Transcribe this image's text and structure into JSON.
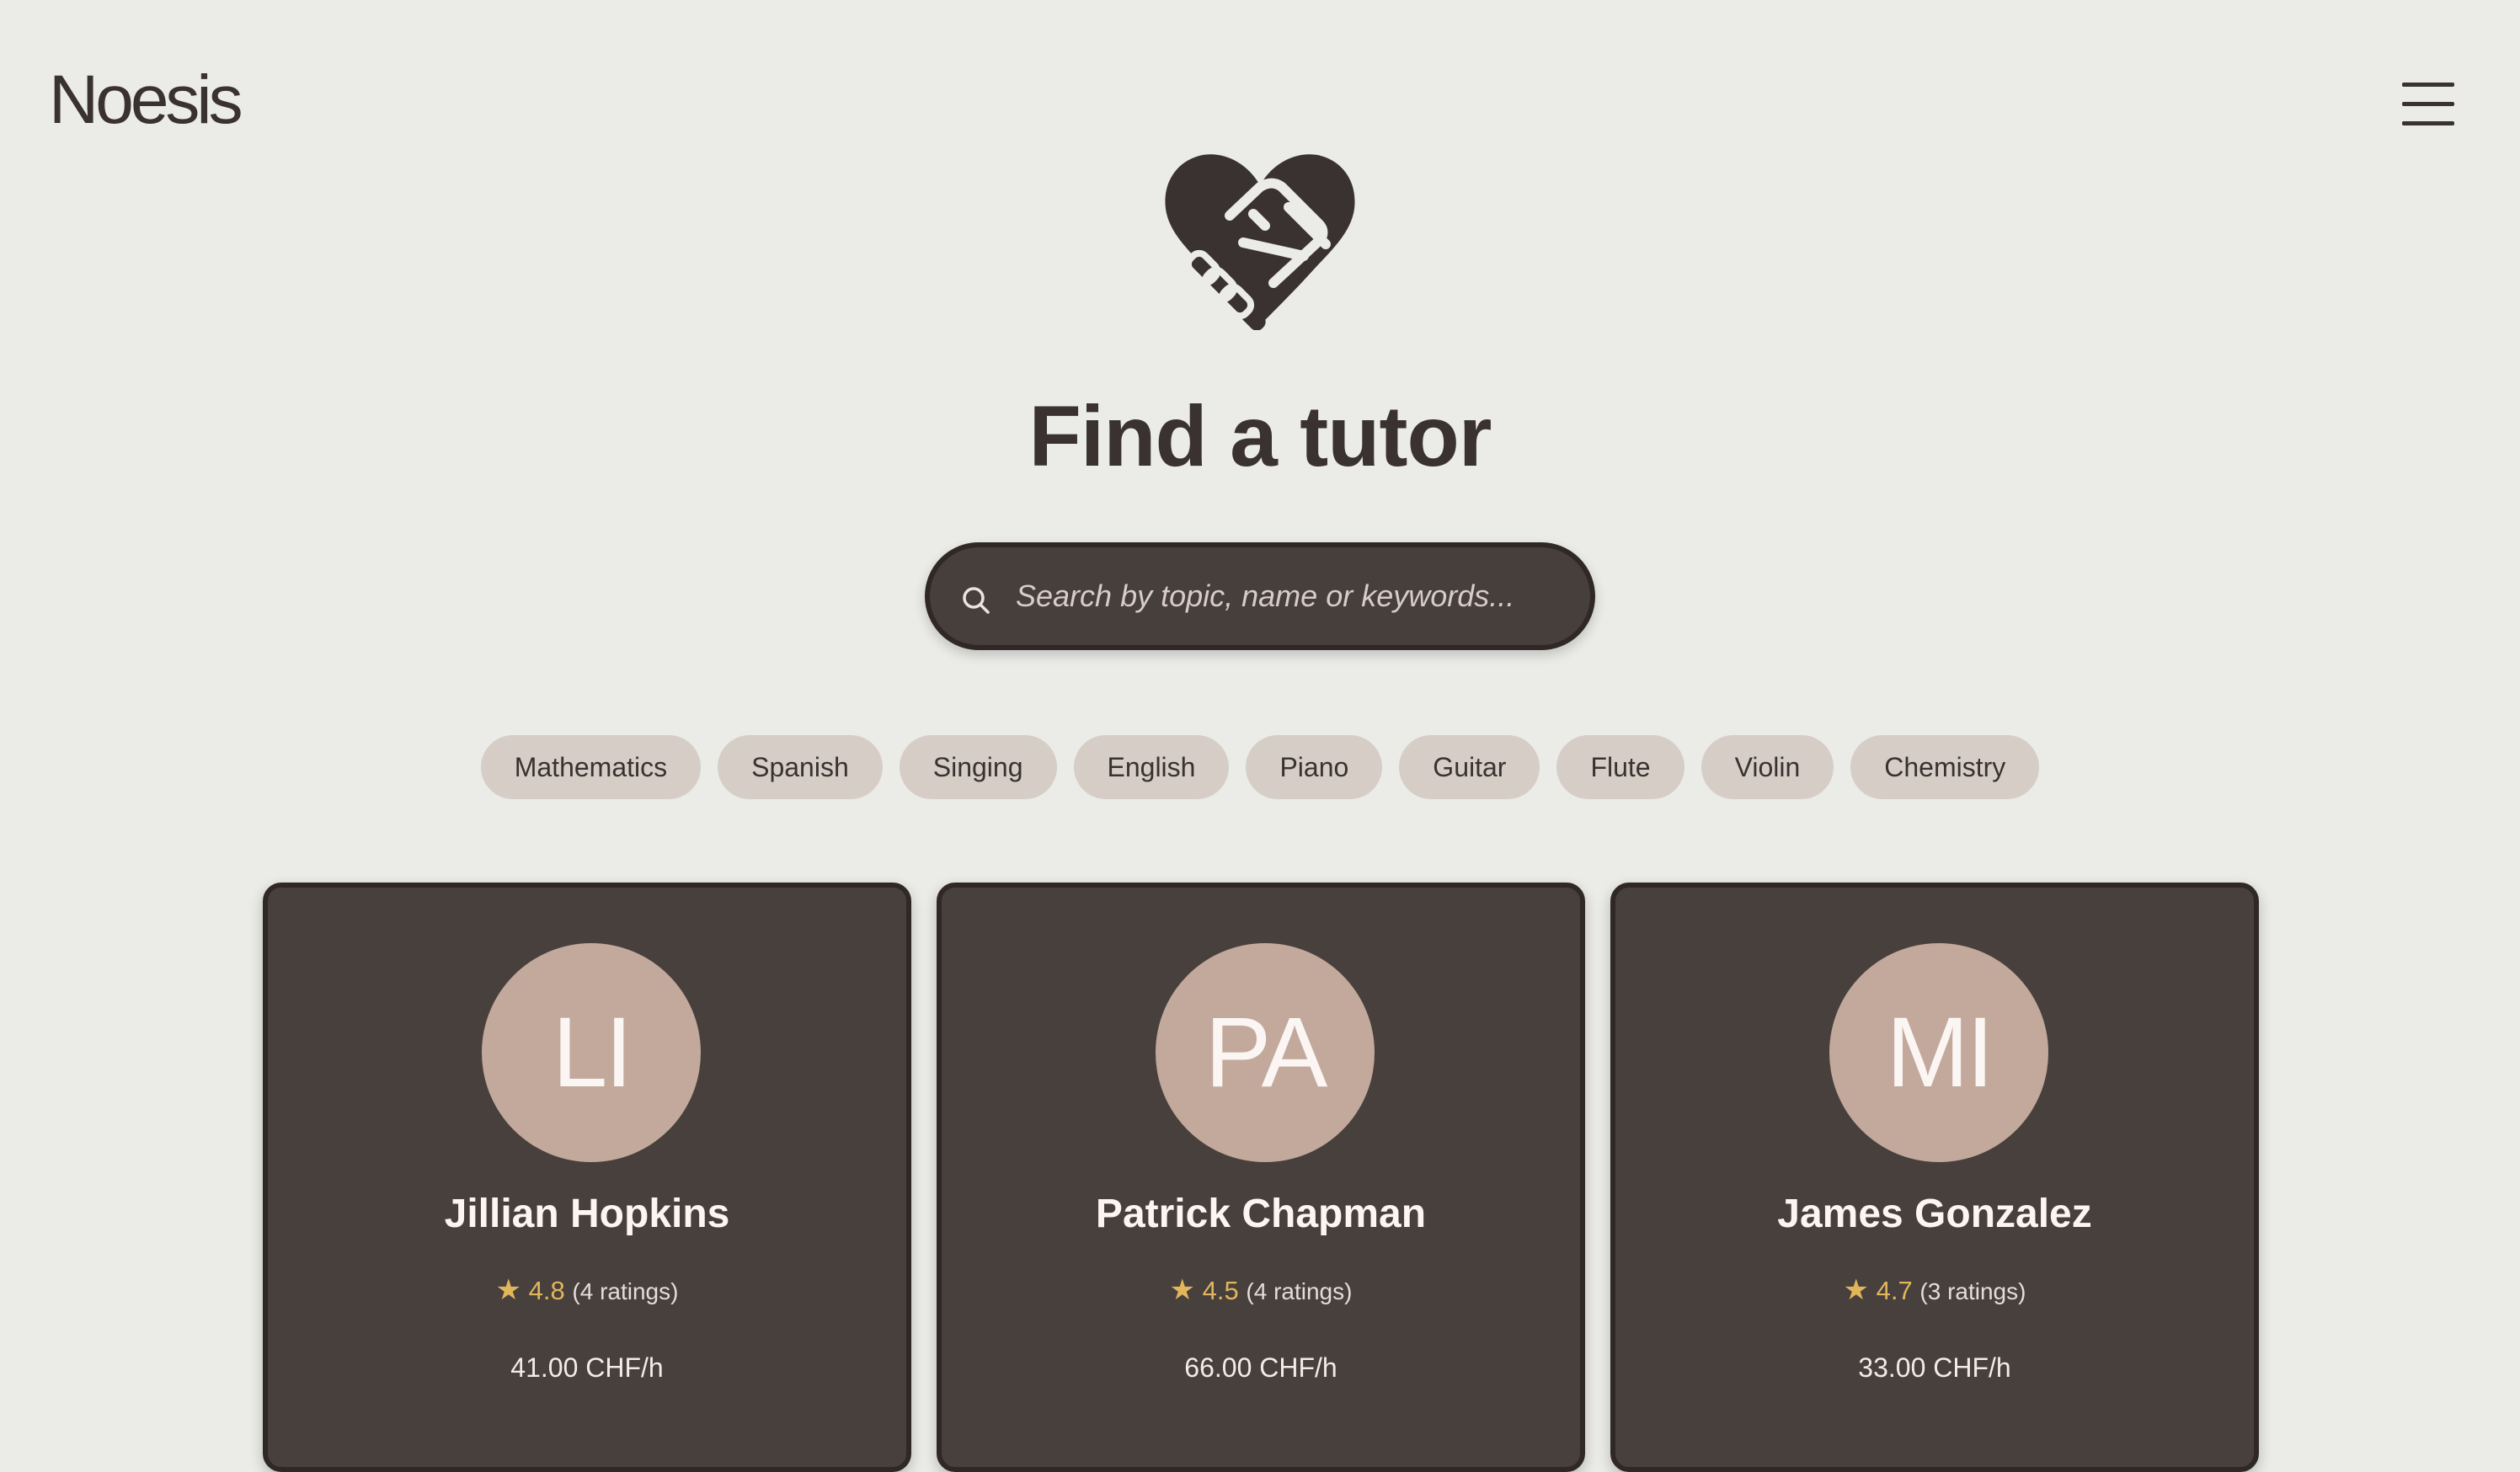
{
  "app": {
    "title": "Noesis"
  },
  "header": {
    "menu_icon": "hamburger-menu-icon",
    "hero_icon": "heart-handshake-icon"
  },
  "main": {
    "title": "Find a tutor",
    "search": {
      "placeholder": "Search by topic, name or keywords...",
      "value": "",
      "icon": "search-icon"
    },
    "topics": [
      "Mathematics",
      "Spanish",
      "Singing",
      "English",
      "Piano",
      "Guitar",
      "Flute",
      "Violin",
      "Chemistry"
    ],
    "tutors": [
      {
        "initials": "LI",
        "name": "Jillian Hopkins",
        "rating": "4.8",
        "ratings_count": "(4 ratings)",
        "price": "41.00 CHF/h"
      },
      {
        "initials": "PA",
        "name": "Patrick Chapman",
        "rating": "4.5",
        "ratings_count": "(4 ratings)",
        "price": "66.00 CHF/h"
      },
      {
        "initials": "MI",
        "name": "James Gonzalez",
        "rating": "4.7",
        "ratings_count": "(3 ratings)",
        "price": "33.00 CHF/h"
      }
    ]
  },
  "colors": {
    "background": "#ebebe7",
    "text_dark": "#3a3230",
    "card_bg": "#48403d",
    "chip_bg": "#d6cdc6",
    "avatar_bg": "#c2a99b",
    "star": "#e0b65b"
  }
}
